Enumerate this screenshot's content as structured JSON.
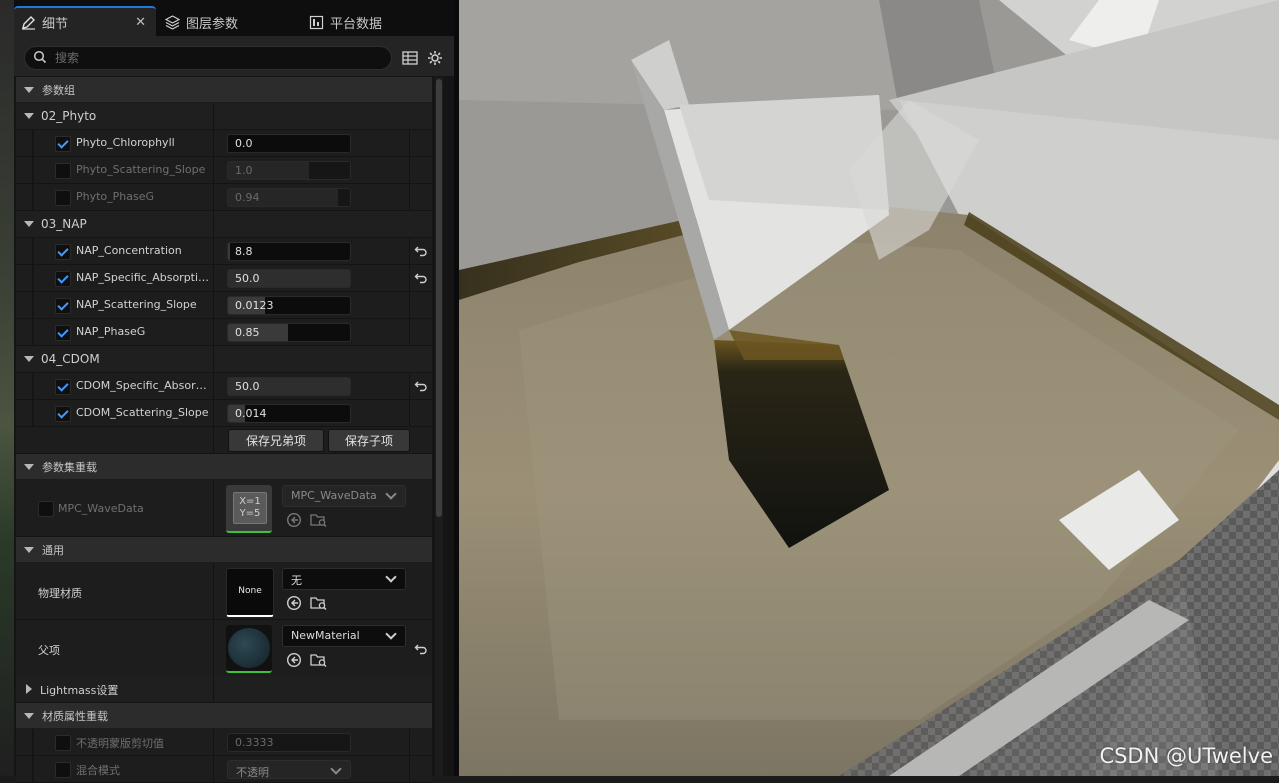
{
  "tabs": [
    {
      "label": "细节",
      "icon": "pencil-icon",
      "active": true
    },
    {
      "label": "图层参数",
      "icon": "layers-icon",
      "active": false
    },
    {
      "label": "平台数据",
      "icon": "platform-icon",
      "active": false
    }
  ],
  "search": {
    "placeholder": "搜索"
  },
  "sections": {
    "params_group": "参数组",
    "param_set_overrides": "参数集重载",
    "general": "通用",
    "lightmass": "Lightmass设置",
    "material_overrides": "材质属性重载"
  },
  "groups": {
    "phyto": "02_Phyto",
    "nap": "03_NAP",
    "cdom": "04_CDOM"
  },
  "params": {
    "phyto_chlorophyll": {
      "label": "Phyto_Chlorophyll",
      "value": "0.0",
      "checked": true
    },
    "phyto_scattering_slope": {
      "label": "Phyto_Scattering_Slope",
      "value": "1.0",
      "checked": false
    },
    "phyto_phaseg": {
      "label": "Phyto_PhaseG",
      "value": "0.94",
      "checked": false
    },
    "nap_concentration": {
      "label": "NAP_Concentration",
      "value": "8.8",
      "checked": true
    },
    "nap_specific_absorption": {
      "label": "NAP_Specific_Absorption_Coefficient",
      "value": "50.0",
      "checked": true
    },
    "nap_scattering_slope": {
      "label": "NAP_Scattering_Slope",
      "value": "0.0123",
      "checked": true
    },
    "nap_phaseg": {
      "label": "NAP_PhaseG",
      "value": "0.85",
      "checked": true
    },
    "cdom_specific_absorption": {
      "label": "CDOM_Specific_Absorption_Coefficient",
      "value": "50.0",
      "checked": true
    },
    "cdom_scattering_slope": {
      "label": "CDOM_Scattering_Slope",
      "value": "0.014",
      "checked": true
    }
  },
  "buttons": {
    "save_siblings": "保存兄弟项",
    "save_children": "保存子项"
  },
  "mpc": {
    "label": "MPC_WaveData",
    "combo": "MPC_WaveData",
    "thumb_line1": "X=1",
    "thumb_line2": "Y=5"
  },
  "general": {
    "phys_material_label": "物理材质",
    "phys_material_thumb": "None",
    "phys_material_value": "无",
    "parent_label": "父项",
    "parent_value": "NewMaterial"
  },
  "material_overrides": {
    "opacity_mask_label": "不透明蒙版剪切值",
    "opacity_mask_value": "0.3333",
    "blend_mode_label": "混合模式",
    "blend_mode_value": "不透明"
  },
  "watermark": "CSDN @UTwelve",
  "colors": {
    "accent": "#1f7ad8",
    "check": "#3d9bff",
    "asset_underline": "#3ec23e"
  }
}
